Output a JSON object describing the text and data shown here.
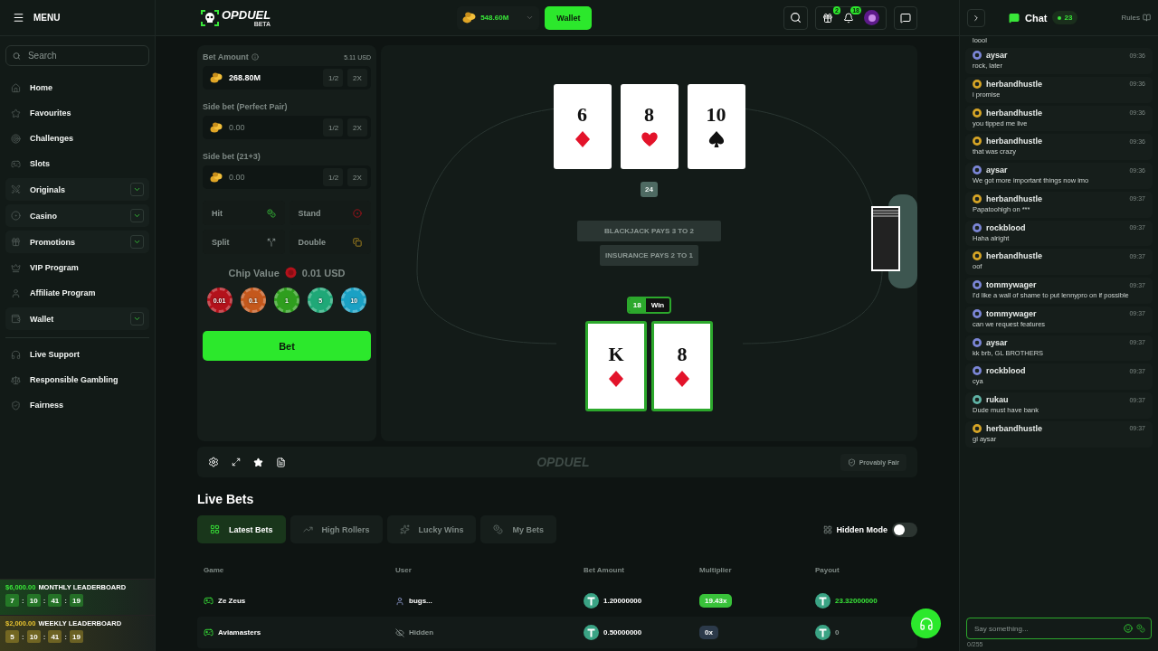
{
  "sidebar": {
    "menu_label": "MENU",
    "search": {
      "placeholder": "Search"
    },
    "items": [
      {
        "label": "Home",
        "expandable": false
      },
      {
        "label": "Favourites",
        "expandable": false
      },
      {
        "label": "Challenges",
        "expandable": false
      },
      {
        "label": "Slots",
        "expandable": false
      },
      {
        "label": "Originals",
        "expandable": true
      },
      {
        "label": "Casino",
        "expandable": true
      },
      {
        "label": "Promotions",
        "expandable": true
      },
      {
        "label": "VIP Program",
        "expandable": false
      },
      {
        "label": "Affiliate Program",
        "expandable": false
      },
      {
        "label": "Wallet",
        "expandable": true
      }
    ],
    "footer_items": [
      {
        "label": "Live Support"
      },
      {
        "label": "Responsible Gambling"
      },
      {
        "label": "Fairness"
      }
    ],
    "leaderboards": [
      {
        "prize": "$6,000.00",
        "title": "MONTHLY LEADERBOARD",
        "color": "#39e639",
        "timer": [
          "7",
          ":",
          "10",
          ":",
          "41",
          ":",
          "19"
        ]
      },
      {
        "prize": "$2,000.00",
        "title": "WEEKLY LEADERBOARD",
        "color": "#e6c230",
        "timer": [
          "5",
          ":",
          "10",
          ":",
          "41",
          ":",
          "19"
        ]
      }
    ]
  },
  "header": {
    "logo": {
      "name": "OPDUEL",
      "tag": "BETA"
    },
    "balance": "548.60M",
    "wallet_button": "Wallet",
    "gift_count": "2",
    "notification_count": "18"
  },
  "bet_panel": {
    "fields": [
      {
        "label": "Bet Amount",
        "info": true,
        "usd": "5.11 USD",
        "value": "268.80M",
        "half": "1/2",
        "double": "2X"
      },
      {
        "label": "Side bet (Perfect Pair)",
        "placeholder": "0.00",
        "half": "1/2",
        "double": "2X"
      },
      {
        "label": "Side bet (21+3)",
        "placeholder": "0.00",
        "half": "1/2",
        "double": "2X"
      }
    ],
    "actions": [
      {
        "label": "Hit",
        "kind": "hit",
        "disabled": true
      },
      {
        "label": "Stand",
        "kind": "stand",
        "disabled": true
      },
      {
        "label": "Split",
        "kind": "split",
        "disabled": true
      },
      {
        "label": "Double",
        "kind": "double",
        "disabled": true
      }
    ],
    "chip_value_label": "Chip Value",
    "chip_value": "0.01 USD",
    "chips": [
      {
        "label": "0.01",
        "color": "#b3121b"
      },
      {
        "label": "0.1",
        "color": "#c4581c"
      },
      {
        "label": "1",
        "color": "#2f9e1e"
      },
      {
        "label": "5",
        "color": "#1fa877"
      },
      {
        "label": "10",
        "color": "#1aa1c4"
      }
    ],
    "bet_button": "Bet"
  },
  "table": {
    "dealer": {
      "cards": [
        {
          "rank": "6",
          "kind": "diamond"
        },
        {
          "rank": "8",
          "kind": "heart"
        },
        {
          "rank": "10",
          "kind": "spade"
        }
      ],
      "total": "24"
    },
    "banners": [
      "BLACKJACK PAYS 3 TO 2",
      "INSURANCE PAYS 2 TO 1"
    ],
    "player": {
      "total": "18",
      "result": "Win",
      "winner": true,
      "cards": [
        {
          "rank": "K",
          "kind": "diamond"
        },
        {
          "rank": "8",
          "kind": "diamond"
        }
      ]
    }
  },
  "game_bar": {
    "brand": "OPDUEL",
    "provably_fair": "Provably Fair"
  },
  "live_bets": {
    "title": "Live Bets",
    "tabs": [
      {
        "label": "Latest Bets",
        "selected": true
      },
      {
        "label": "High Rollers",
        "selected": false
      },
      {
        "label": "Lucky Wins",
        "selected": false
      },
      {
        "label": "My Bets",
        "selected": false
      }
    ],
    "hidden_mode": {
      "label": "Hidden Mode",
      "on": false
    },
    "columns": [
      "Game",
      "User",
      "Bet Amount",
      "Multiplier",
      "Payout"
    ],
    "rows": [
      {
        "game": "Ze Zeus",
        "user": "bugs...",
        "hidden": false,
        "bet": "1.20000000",
        "multiplier": "19.43x",
        "payout": "23.32000000",
        "win": true
      },
      {
        "game": "Aviamasters",
        "user": "Hidden",
        "hidden": true,
        "bet": "0.50000000",
        "multiplier": "0x",
        "payout": "0",
        "win": false
      }
    ]
  },
  "chat": {
    "title": "Chat",
    "online": "23",
    "rules": "Rules",
    "cut_message": "loool",
    "messages": [
      {
        "user": "aysar",
        "time": "09:36",
        "text": "rock, later",
        "color": "#7b86d6"
      },
      {
        "user": "herbandhustle",
        "time": "09:36",
        "text": "i promise",
        "color": "#d6a526"
      },
      {
        "user": "herbandhustle",
        "time": "09:36",
        "text": "you tipped me live",
        "color": "#d6a526"
      },
      {
        "user": "herbandhustle",
        "time": "09:36",
        "text": "that was crazy",
        "color": "#d6a526"
      },
      {
        "user": "aysar",
        "time": "09:36",
        "text": "We got more important things now imo",
        "color": "#7b86d6"
      },
      {
        "user": "herbandhustle",
        "time": "09:37",
        "text": "Papatoohigh on ***",
        "color": "#d6a526"
      },
      {
        "user": "rockblood",
        "time": "09:37",
        "text": "Haha alright",
        "color": "#7b86d6"
      },
      {
        "user": "herbandhustle",
        "time": "09:37",
        "text": "oof",
        "color": "#d6a526"
      },
      {
        "user": "tommywager",
        "time": "09:37",
        "text": "I'd like a wall of shame to put lennypro on if possible",
        "color": "#7b86d6"
      },
      {
        "user": "tommywager",
        "time": "09:37",
        "text": "can we request features",
        "color": "#7b86d6"
      },
      {
        "user": "aysar",
        "time": "09:37",
        "text": "kk brb, GL BROTHERS",
        "color": "#7b86d6"
      },
      {
        "user": "rockblood",
        "time": "09:37",
        "text": "cya",
        "color": "#7b86d6"
      },
      {
        "user": "rukau",
        "time": "09:37",
        "text": "Dude must have bank",
        "color": "#5fb3a5"
      },
      {
        "user": "herbandhustle",
        "time": "09:37",
        "text": "gl aysar",
        "color": "#d6a526"
      }
    ],
    "input": {
      "placeholder": "Say something...",
      "counter": "0/255"
    }
  }
}
